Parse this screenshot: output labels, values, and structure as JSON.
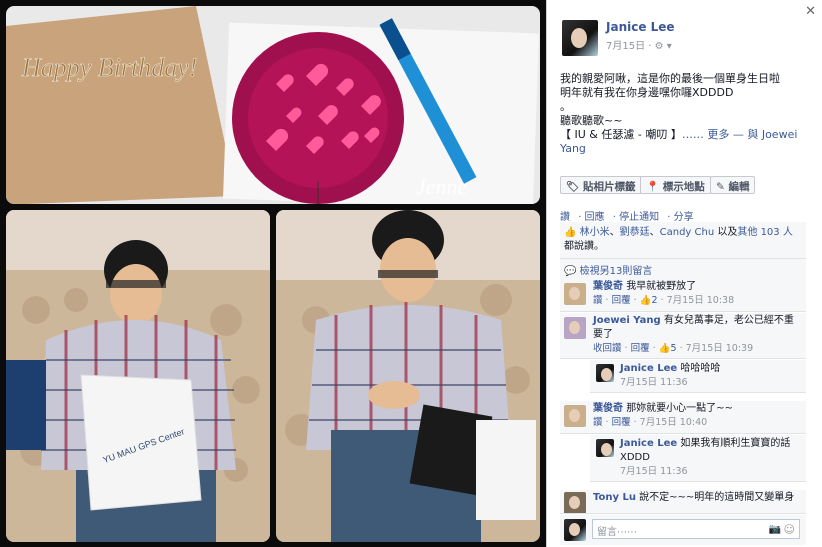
{
  "photos": {
    "card_text": "Happy Birthday!",
    "signature": "Jenne",
    "bag_brand": "YU MAU GPS Center"
  },
  "post": {
    "author": "Janice Lee",
    "date": "7月15日 · ",
    "privacy_icon": "gear-icon",
    "line1": "我的親愛阿啾，這是你的最後一個單身生日啦",
    "line2": "明年就有我在你身邊嘿你囉XDDDD",
    "line3": "。",
    "line4": "聽歌聽歌~~",
    "song": "【 IU & 任瑟濾 - 嘲叨 】",
    "more": "…… 更多 — 與 ",
    "with_person": "Joewei Yang"
  },
  "buttons": {
    "tag": "貼相片標籤",
    "location": "標示地點",
    "edit": "編輯"
  },
  "actions": [
    "讚",
    "· 回應",
    "· 停止通知",
    "· 分享"
  ],
  "likes": {
    "text_a": "林小米",
    "text_b": "、",
    "text_c": "劉恭廷",
    "text_d": "、",
    "text_e": "Candy Chu",
    "text_f": " 以及",
    "text_g": "其他 103 人",
    "text_h": "都說讚。"
  },
  "view_previous": "檢視另13則留言",
  "comments": [
    {
      "name": "葉俊奇",
      "text": "我早就被野放了",
      "like": "讚",
      "reply": "回覆",
      "count": "2",
      "time": "7月15日 10:38"
    },
    {
      "name": "Joewei Yang",
      "text": "有女兒萬事足，老公已經不重要了",
      "like": "收回讚",
      "reply": "回覆",
      "count": "5",
      "time": "7月15日 10:39"
    },
    {
      "name": "Janice Lee",
      "text": "哈哈哈哈",
      "time": "7月15日 11:36"
    },
    {
      "name": "葉俊奇",
      "text": "那妳就要小心一點了~~",
      "like": "讚",
      "reply": "回覆",
      "time": "7月15日 10:40"
    },
    {
      "name": "Janice Lee",
      "text": "如果我有順利生寶寶的話 XDDD",
      "time": "7月15日 11:36"
    },
    {
      "name": "Tony Lu",
      "text": "說不定~~~明年的這時間又變單身"
    }
  ],
  "comment_input": {
    "placeholder": "留言⋯⋯"
  }
}
